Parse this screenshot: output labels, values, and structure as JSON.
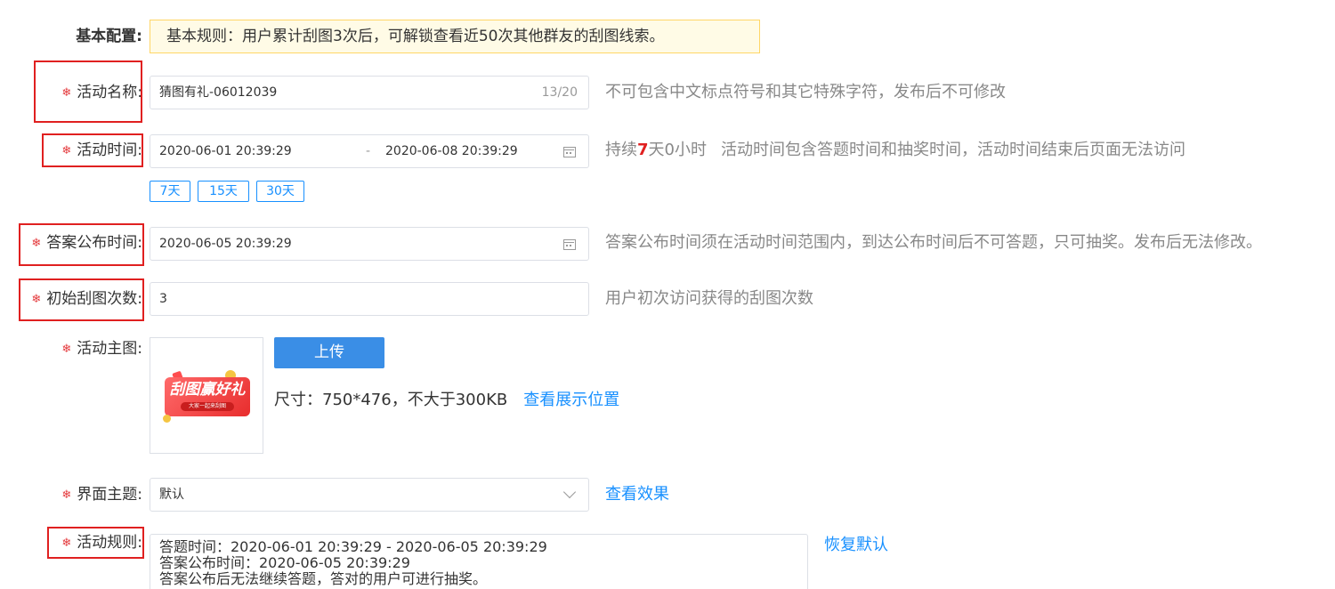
{
  "basic": {
    "label": "基本配置:",
    "notice": "基本规则：用户累计刮图3次后，可解锁查看近50次其他群友的刮图线索。"
  },
  "required_mark": "❄",
  "activity_name": {
    "label": "活动名称:",
    "value": "猜图有礼-06012039",
    "counter": "13/20",
    "hint": "不可包含中文标点符号和其它特殊字符，发布后不可修改"
  },
  "activity_time": {
    "label": "活动时间:",
    "start": "2020-06-01 20:39:29",
    "separator": "-",
    "end": "2020-06-08 20:39:29",
    "hint_prefix": "持续",
    "hint_days": "7",
    "hint_middle": "天0小时",
    "hint_rest": "活动时间包含答题时间和抽奖时间，活动时间结束后页面无法访问",
    "quick": [
      "7天",
      "15天",
      "30天"
    ]
  },
  "answer_time": {
    "label": "答案公布时间:",
    "value": "2020-06-05 20:39:29",
    "hint": "答案公布时间须在活动时间范围内，到达公布时间后不可答题，只可抽奖。发布后无法修改。"
  },
  "scratch_count": {
    "label": "初始刮图次数:",
    "value": "3",
    "hint": "用户初次访问获得的刮图次数"
  },
  "main_image": {
    "label": "活动主图:",
    "banner_text": "刮图赢好礼",
    "banner_sub": "大家一起来刮图",
    "upload_label": "上传",
    "size_text": "尺寸：750*476，不大于300KB",
    "view_position": "查看展示位置"
  },
  "theme": {
    "label": "界面主题:",
    "value": "默认",
    "view_effect": "查看效果"
  },
  "rules": {
    "label": "活动规则:",
    "lines": [
      "答题时间：2020-06-01 20:39:29 - 2020-06-05 20:39:29",
      "答案公布时间：2020-06-05 20:39:29",
      "答案公布后无法继续答题，答对的用户可进行抽奖。"
    ],
    "restore_default": "恢复默认"
  },
  "colors": {
    "required": "#e4393c",
    "highlight_box": "#e02020",
    "link": "#1890ff",
    "upload_button": "#3a8ee6",
    "notice_bg": "#fffbe6"
  }
}
